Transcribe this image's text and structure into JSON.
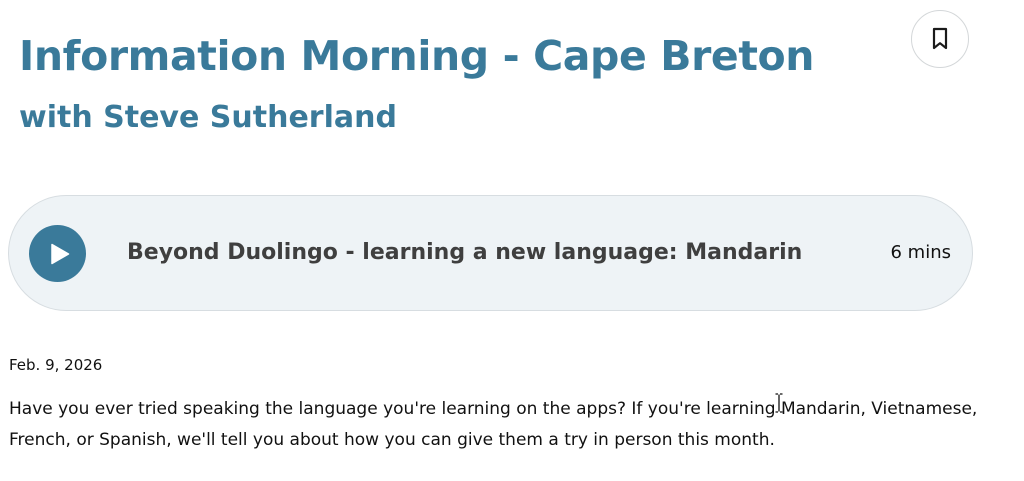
{
  "show": {
    "title": "Information Morning - Cape Breton",
    "host": "with Steve Sutherland"
  },
  "bookmark": {
    "icon": "bookmark-icon"
  },
  "player": {
    "play_icon": "play-icon",
    "episode_title": "Beyond Duolingo - learning a new language: Mandarin",
    "duration": "6 mins"
  },
  "episode": {
    "date": "Feb. 9, 2026",
    "description": "Have you ever tried speaking the language you're learning on the apps? If you're learning Mandarin, Vietnamese, French, or Spanish, we'll tell you about how you can give them a try in person this month."
  },
  "colors": {
    "accent": "#3a7a9a",
    "player_background": "#eef3f6",
    "episode_title_text": "#3f3f3f"
  }
}
